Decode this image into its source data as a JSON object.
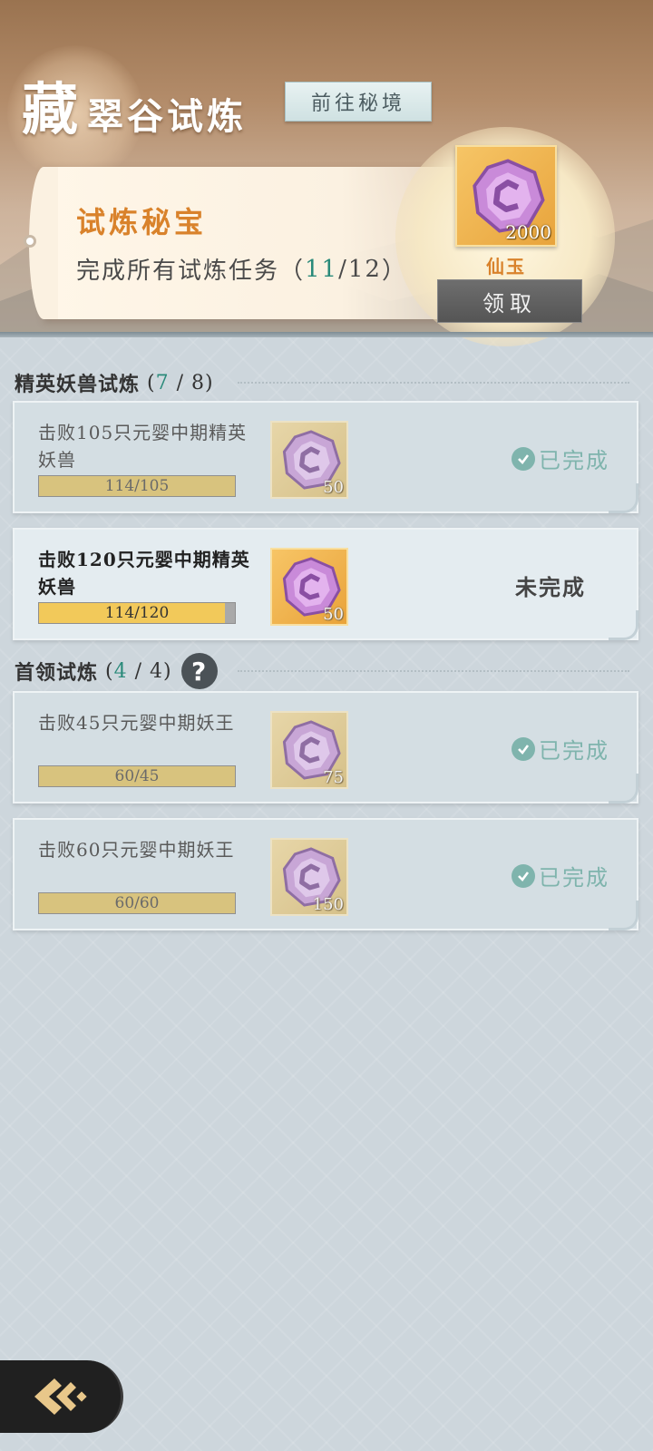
{
  "header": {
    "title_big": "藏",
    "title_rest": "翠谷试炼",
    "goto_label": "前往秘境"
  },
  "treasure": {
    "title": "试炼秘宝",
    "desc_prefix": "完成所有试炼任务（",
    "done": "11",
    "total": "/12",
    "desc_suffix": "）",
    "reward_qty": "2000",
    "reward_name": "仙玉",
    "claim_label": "领取"
  },
  "sections": [
    {
      "title": "精英妖兽试炼",
      "count_open": "(",
      "count_done": "7",
      "count_rest": " / 8)",
      "tasks": [
        {
          "text": "击败105只元婴中期精英妖兽",
          "progress_label": "114/105",
          "progress": 1.0,
          "reward_qty": "50",
          "status": "已完成",
          "state": "done"
        },
        {
          "text": "击败120只元婴中期精英妖兽",
          "progress_label": "114/120",
          "progress": 0.95,
          "reward_qty": "50",
          "status": "未完成",
          "state": "active"
        }
      ]
    },
    {
      "title": "首领试炼",
      "count_open": "(",
      "count_done": "4",
      "count_rest": " / 4)",
      "help_glyph": "?",
      "tasks": [
        {
          "text": "击败45只元婴中期妖王",
          "progress_label": "60/45",
          "progress": 1.0,
          "reward_qty": "75",
          "status": "已完成",
          "state": "done"
        },
        {
          "text": "击败60只元婴中期妖王",
          "progress_label": "60/60",
          "progress": 1.0,
          "reward_qty": "150",
          "status": "已完成",
          "state": "done"
        }
      ]
    }
  ],
  "colors": {
    "accent_orange": "#d9822b",
    "accent_teal": "#2a8a7a",
    "done_green": "#7fb4ad",
    "jade_purple": "#b57ad0"
  },
  "icons": {
    "reward_item": "xian-yu-jade-icon",
    "done": "check-circle-icon",
    "help": "question-icon",
    "back": "back-arrow-icon"
  }
}
